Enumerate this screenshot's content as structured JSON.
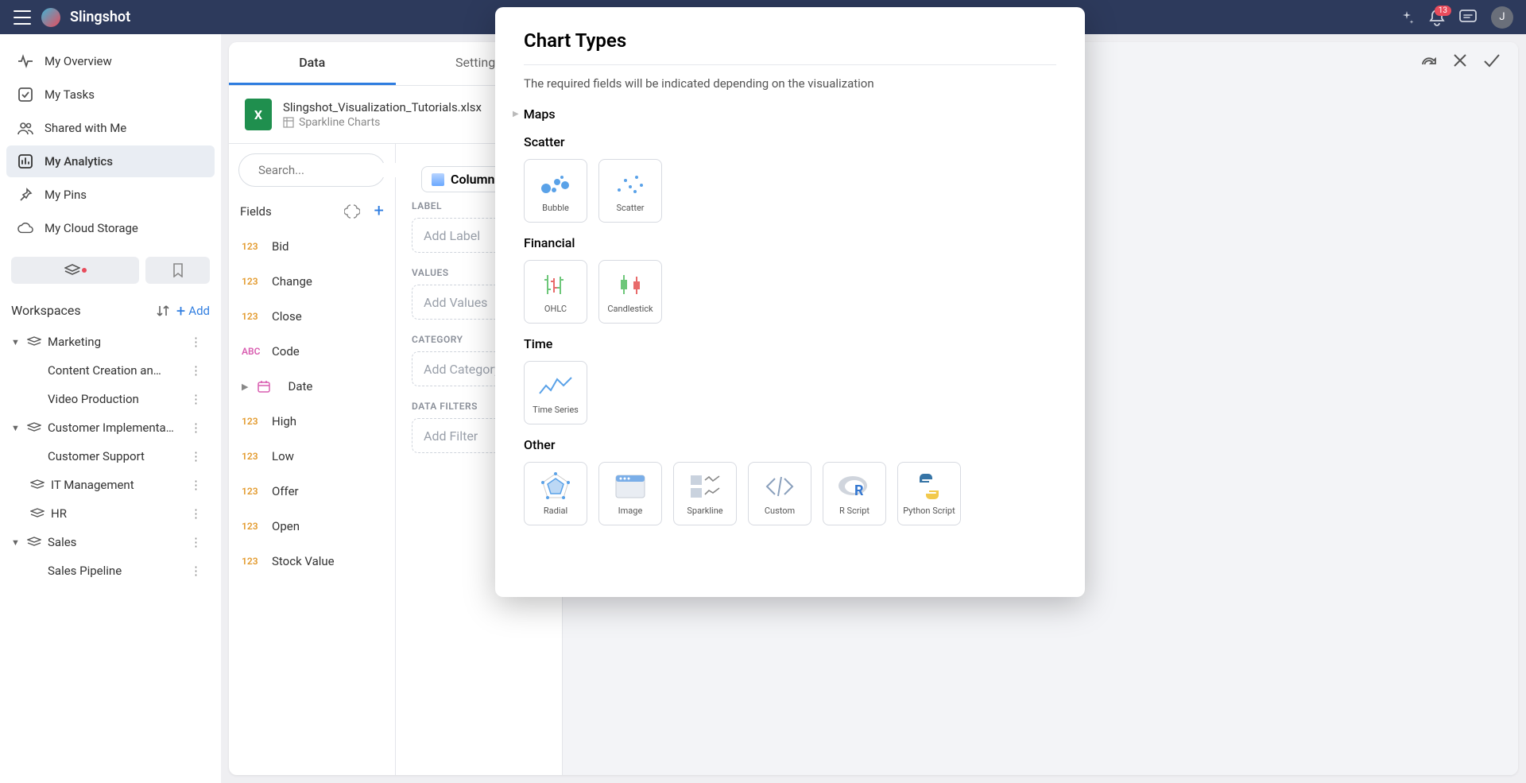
{
  "brand": "Slingshot",
  "notifications_count": "13",
  "avatar_initial": "J",
  "nav": {
    "overview": "My Overview",
    "tasks": "My Tasks",
    "shared": "Shared with Me",
    "analytics": "My Analytics",
    "pins": "My Pins",
    "cloud": "My Cloud Storage"
  },
  "workspaces": {
    "title": "Workspaces",
    "add_label": "Add",
    "items": [
      {
        "label": "Marketing",
        "expanded": true,
        "children": [
          {
            "label": "Content Creation an…"
          },
          {
            "label": "Video Production"
          }
        ]
      },
      {
        "label": "Customer Implementa…",
        "expanded": true,
        "children": [
          {
            "label": "Customer Support"
          }
        ]
      },
      {
        "label": "IT Management"
      },
      {
        "label": "HR"
      },
      {
        "label": "Sales",
        "expanded": true,
        "children": [
          {
            "label": "Sales Pipeline"
          }
        ]
      }
    ]
  },
  "editor": {
    "tabs": {
      "data": "Data",
      "settings": "Settings"
    },
    "file": {
      "name": "Slingshot_Visualization_Tutorials.xlsx",
      "sheet": "Sparkline Charts"
    },
    "search_placeholder": "Search...",
    "fields_label": "Fields",
    "fields": [
      {
        "type": "num",
        "name": "Bid"
      },
      {
        "type": "num",
        "name": "Change"
      },
      {
        "type": "num",
        "name": "Close"
      },
      {
        "type": "abc",
        "name": "Code"
      },
      {
        "type": "date",
        "name": "Date",
        "expandable": true
      },
      {
        "type": "num",
        "name": "High"
      },
      {
        "type": "num",
        "name": "Low"
      },
      {
        "type": "num",
        "name": "Offer"
      },
      {
        "type": "num",
        "name": "Open"
      },
      {
        "type": "num",
        "name": "Stock Value"
      }
    ],
    "chart_type_label": "Column",
    "drops": {
      "label_title": "LABEL",
      "label_ph": "Add Label",
      "values_title": "VALUES",
      "values_ph": "Add Values",
      "category_title": "CATEGORY",
      "category_ph": "Add Category",
      "filters_title": "DATA FILTERS",
      "filters_ph": "Add Filter"
    }
  },
  "modal": {
    "title": "Chart Types",
    "desc": "The required fields will be indicated depending on the visualization",
    "sections": {
      "maps": "Maps",
      "scatter": "Scatter",
      "financial": "Financial",
      "time": "Time",
      "other": "Other"
    },
    "cards": {
      "bubble": "Bubble",
      "scatter": "Scatter",
      "ohlc": "OHLC",
      "candlestick": "Candlestick",
      "timeseries": "Time Series",
      "radial": "Radial",
      "image": "Image",
      "sparkline": "Sparkline",
      "custom": "Custom",
      "rscript": "R Script",
      "pyscript": "Python Script"
    }
  }
}
